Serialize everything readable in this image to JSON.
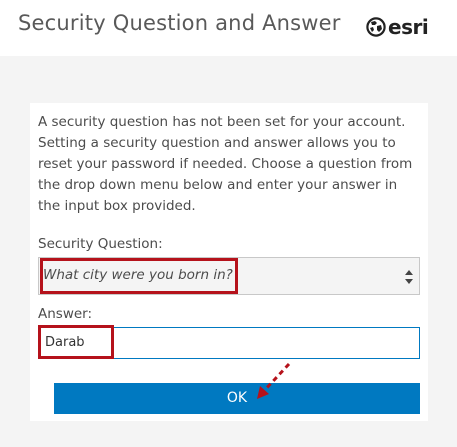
{
  "header": {
    "title": "Security Question and Answer",
    "logo_text": "esri"
  },
  "form": {
    "intro_lines": [
      "A security question has not been set for your account.",
      "Setting a security question and answer allows you to",
      "reset your password if needed. Choose a question from",
      "the drop down menu below and enter your answer in",
      "the input box provided."
    ],
    "question_label": "Security Question:",
    "question_value": "What city were you born in?",
    "answer_label": "Answer:",
    "answer_value": "Darab",
    "ok_label": "OK"
  },
  "colors": {
    "accent": "#0079c1",
    "highlight": "#b5121b",
    "page_bg": "#f4f4f4"
  },
  "icons": {
    "logo": "esri-globe-icon",
    "select": "select-arrows-icon",
    "annotation": "dashed-arrow-icon"
  }
}
